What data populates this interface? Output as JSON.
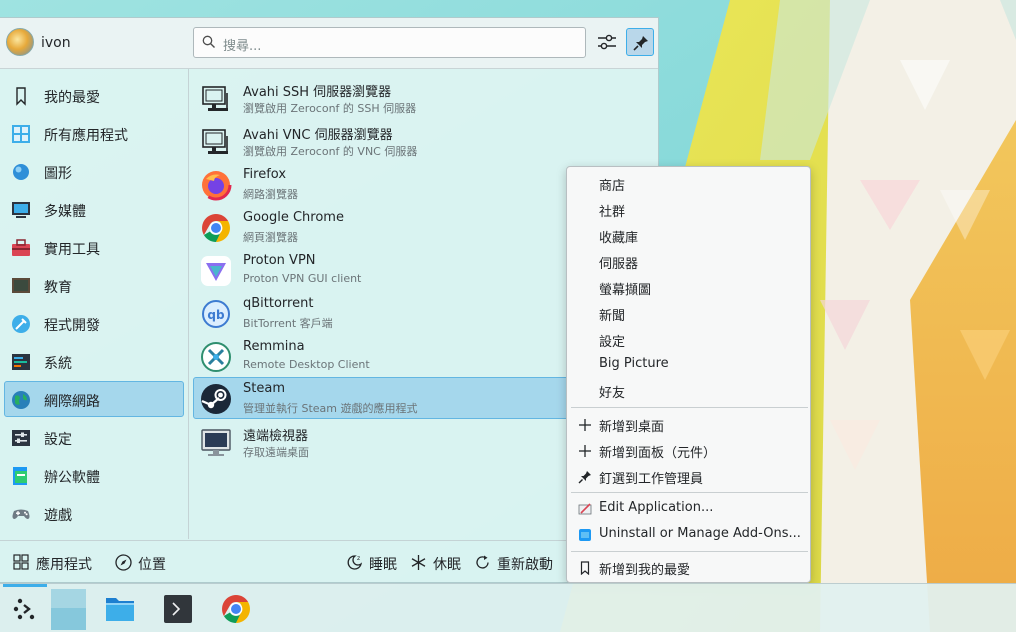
{
  "user": {
    "name": "ivon"
  },
  "search": {
    "placeholder": "搜尋..."
  },
  "categories": [
    {
      "label": "我的最愛",
      "icon": "bookmark-icon"
    },
    {
      "label": "所有應用程式",
      "icon": "grid-icon"
    },
    {
      "label": "圖形",
      "icon": "graphics-icon"
    },
    {
      "label": "多媒體",
      "icon": "multimedia-icon"
    },
    {
      "label": "實用工具",
      "icon": "toolbox-icon"
    },
    {
      "label": "教育",
      "icon": "education-icon"
    },
    {
      "label": "程式開發",
      "icon": "development-icon"
    },
    {
      "label": "系統",
      "icon": "system-icon"
    },
    {
      "label": "網際網路",
      "icon": "globe-icon",
      "active": true
    },
    {
      "label": "設定",
      "icon": "settings-icon"
    },
    {
      "label": "辦公軟體",
      "icon": "office-icon"
    },
    {
      "label": "遊戲",
      "icon": "gamepad-icon"
    }
  ],
  "apps": [
    {
      "name": "Avahi SSH 伺服器瀏覽器",
      "desc": "瀏覽啟用 Zeroconf 的 SSH 伺服器",
      "icon": "network-terminal-icon"
    },
    {
      "name": "Avahi VNC 伺服器瀏覽器",
      "desc": "瀏覽啟用 Zeroconf 的 VNC 伺服器",
      "icon": "network-terminal-icon"
    },
    {
      "name": "Firefox",
      "desc": "網路瀏覽器",
      "icon": "firefox-icon"
    },
    {
      "name": "Google Chrome",
      "desc": "網頁瀏覽器",
      "icon": "chrome-icon"
    },
    {
      "name": "Proton VPN",
      "desc": "Proton VPN GUI client",
      "icon": "protonvpn-icon"
    },
    {
      "name": "qBittorrent",
      "desc": "BitTorrent 客戶端",
      "icon": "qbittorrent-icon"
    },
    {
      "name": "Remmina",
      "desc": "Remote Desktop Client",
      "icon": "remmina-icon"
    },
    {
      "name": "Steam",
      "desc": "管理並執行 Steam 遊戲的應用程式",
      "icon": "steam-icon",
      "active": true
    },
    {
      "name": "遠端檢視器",
      "desc": "存取遠端桌面",
      "icon": "remote-viewer-icon"
    }
  ],
  "footer": {
    "applications": "應用程式",
    "places": "位置",
    "sleep": "睡眠",
    "hibernate": "休眠",
    "restart": "重新啟動"
  },
  "context_menu": {
    "actions": [
      "商店",
      "社群",
      "收藏庫",
      "伺服器",
      "螢幕擷圖",
      "新聞",
      "設定",
      "Big Picture",
      "好友"
    ],
    "add_to_desktop": "新增到桌面",
    "add_to_panel": "新增到面板（元件）",
    "pin_to_task_manager": "釘選到工作管理員",
    "edit_application": "Edit Application...",
    "uninstall": "Uninstall or Manage Add-Ons...",
    "add_to_favorites": "新增到我的最愛"
  },
  "colors": {
    "accent": "#3daee9",
    "highlight": "#93cee9",
    "wallpaper_yellow": "#e3dc48",
    "wallpaper_orange": "#eeb550",
    "wallpaper_teal": "#7fd6d6"
  }
}
